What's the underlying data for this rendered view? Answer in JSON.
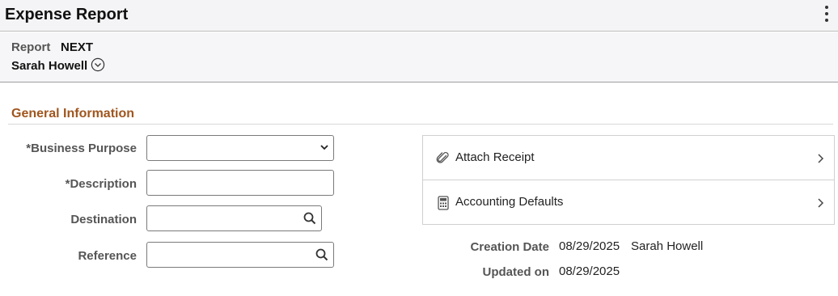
{
  "page": {
    "title": "Expense Report"
  },
  "header": {
    "report_label": "Report",
    "report_value": "NEXT",
    "user_name": "Sarah Howell"
  },
  "general_information": {
    "section_title": "General Information",
    "fields": {
      "business_purpose": {
        "label": "*Business Purpose",
        "value": ""
      },
      "description": {
        "label": "*Description",
        "value": ""
      },
      "destination": {
        "label": "Destination",
        "value": ""
      },
      "reference": {
        "label": "Reference",
        "value": ""
      }
    }
  },
  "cards": {
    "attach_receipt": {
      "label": "Attach Receipt"
    },
    "accounting_defaults": {
      "label": "Accounting Defaults"
    }
  },
  "meta": {
    "creation_date_label": "Creation Date",
    "creation_date": "08/29/2025",
    "created_by": "Sarah Howell",
    "updated_on_label": "Updated on",
    "updated_on": "08/29/2025"
  },
  "colors": {
    "section_title": "#a0561e",
    "title_bar_bg": "#f4f4f6",
    "label_gray": "#555555"
  },
  "icons": {
    "actions": "vertical-ellipsis-icon",
    "user_menu": "chevron-down-circle-icon",
    "dropdown": "chevron-down-icon",
    "lookup": "search-icon",
    "attach": "paperclip-icon",
    "accounting": "calculator-icon",
    "card_arrow": "chevron-right-icon"
  }
}
